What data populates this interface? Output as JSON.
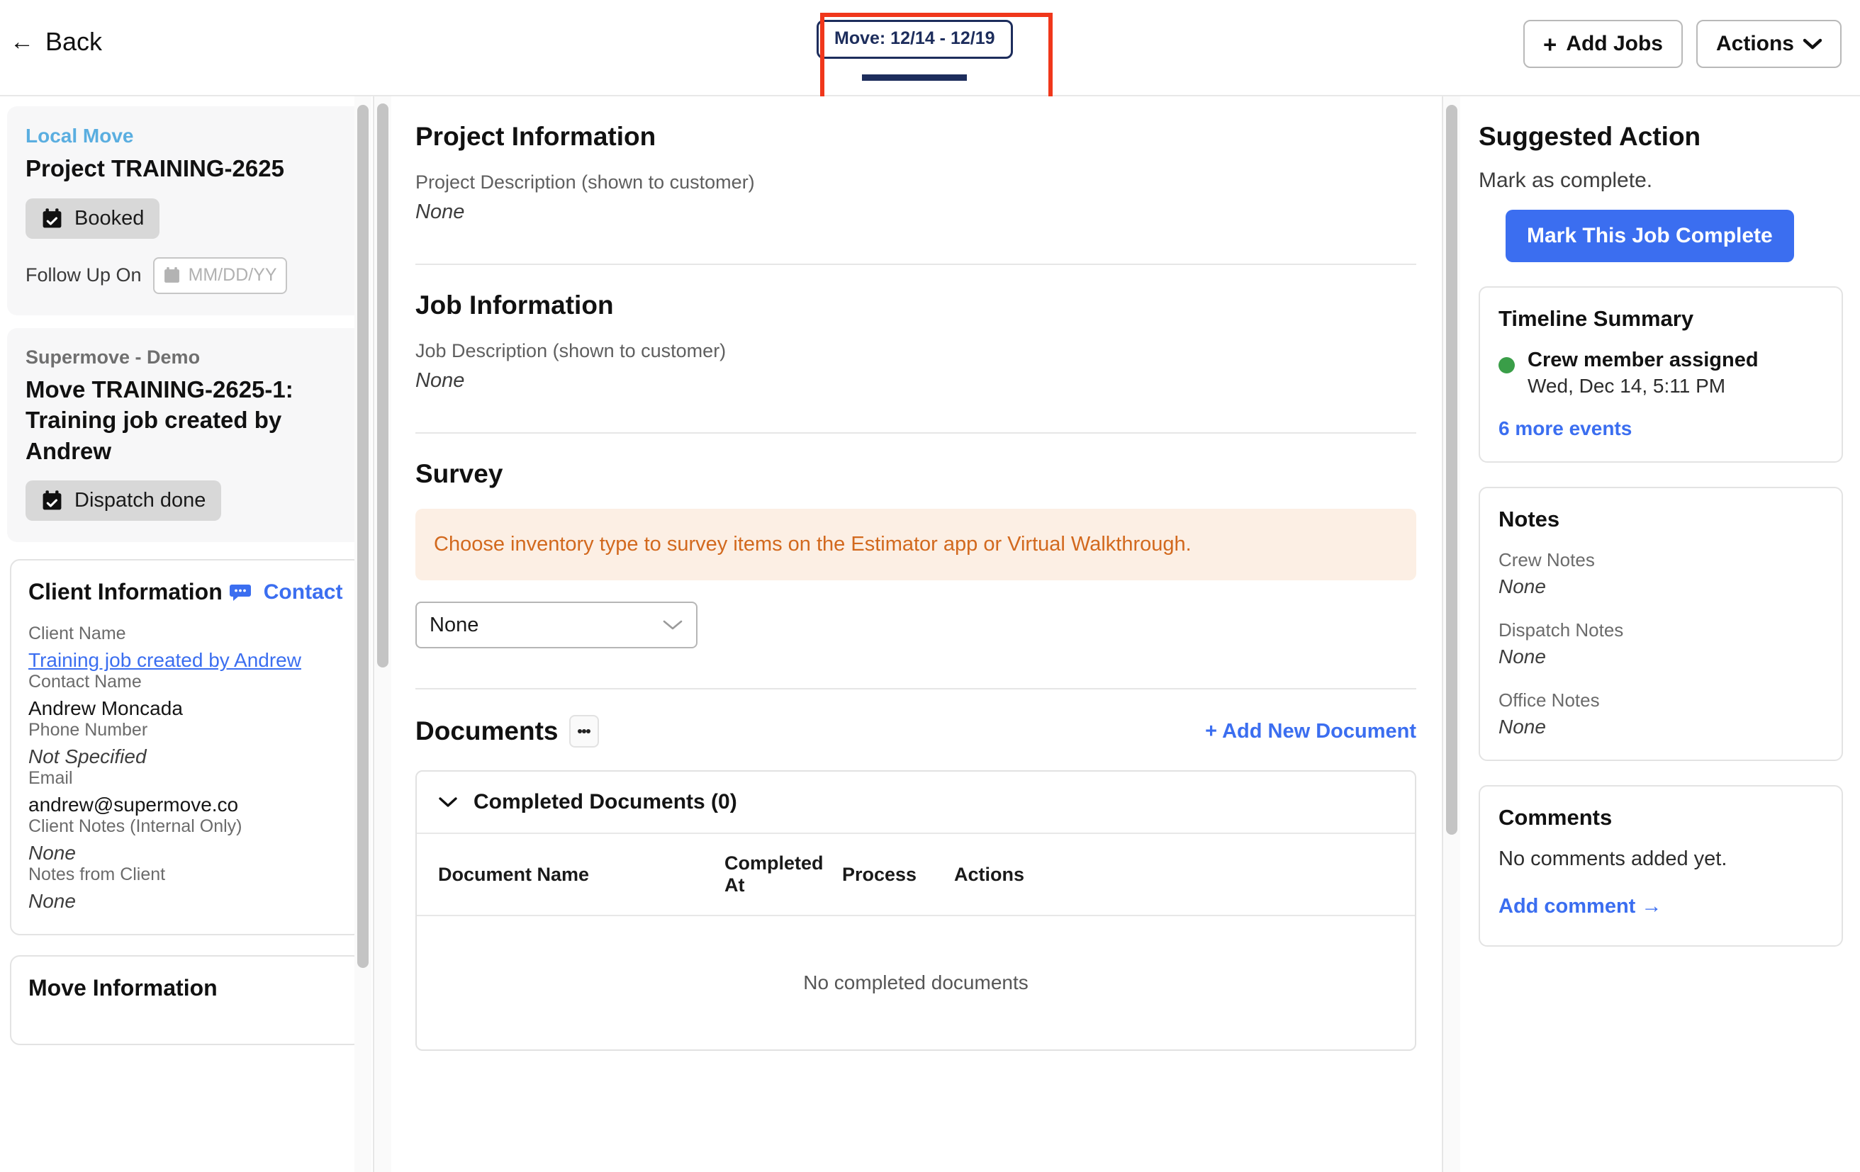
{
  "topbar": {
    "back_label": "Back",
    "back_arrow": "←",
    "tab_label": "Move: 12/14 - 12/19",
    "add_jobs_label": "Add Jobs",
    "plus_icon": "+",
    "actions_label": "Actions",
    "chevron_icon": "⌄",
    "highlight_color": "#f0371b",
    "tab_accent_color": "#1d2d5c"
  },
  "sidebar": {
    "project_card": {
      "kicker": "Local Move",
      "title": "Project TRAINING-2625",
      "status_label": "Booked",
      "followup_label": "Follow Up On",
      "followup_placeholder": "MM/DD/YY",
      "followup_value": ""
    },
    "move_card": {
      "kicker": "Supermove - Demo",
      "title": "Move TRAINING-2625-1: Training job created by Andrew",
      "status_label": "Dispatch done"
    },
    "client_card": {
      "title": "Client Information",
      "contact_link": "Contact",
      "fields": [
        {
          "label": "Client Name",
          "value": "Training job created by Andrew",
          "style": "link"
        },
        {
          "label": "Contact Name",
          "value": "Andrew Moncada",
          "style": "plain"
        },
        {
          "label": "Phone Number",
          "value": "Not Specified",
          "style": "italic"
        },
        {
          "label": "Email",
          "value": "andrew@supermove.co",
          "style": "plain"
        },
        {
          "label": "Client Notes (Internal Only)",
          "value": "None",
          "style": "italic"
        },
        {
          "label": "Notes from Client",
          "value": "None",
          "style": "italic"
        }
      ]
    },
    "move_info_card": {
      "title": "Move Information"
    }
  },
  "main": {
    "project_information": {
      "title": "Project Information",
      "description_label": "Project Description (shown to customer)",
      "description_value": "None"
    },
    "job_information": {
      "title": "Job Information",
      "description_label": "Job Description (shown to customer)",
      "description_value": "None"
    },
    "survey": {
      "title": "Survey",
      "alert_text": "Choose inventory type to survey items on the Estimator app or Virtual Walkthrough.",
      "alert_color": "#d2691e",
      "select_value": "None",
      "select_chevron": "⌄"
    },
    "documents": {
      "title": "Documents",
      "add_label": "+  Add New Document",
      "accordion_label": "Completed Documents (0)",
      "accordion_chevron": "⌄",
      "columns": [
        "Document Name",
        "Completed At",
        "Process",
        "Actions"
      ],
      "empty_text": "No completed documents",
      "rows": []
    }
  },
  "right": {
    "suggested_action": {
      "title": "Suggested Action",
      "subtitle": "Mark as complete.",
      "button_label": "Mark This Job Complete",
      "button_color": "#3b6ef0"
    },
    "timeline": {
      "title": "Timeline Summary",
      "events": [
        {
          "label": "Crew member assigned",
          "time": "Wed, Dec 14, 5:11 PM",
          "dot_color": "#3a9e48"
        }
      ],
      "more_link": "6 more events"
    },
    "notes": {
      "title": "Notes",
      "items": [
        {
          "label": "Crew Notes",
          "value": "None"
        },
        {
          "label": "Dispatch Notes",
          "value": "None"
        },
        {
          "label": "Office Notes",
          "value": "None"
        }
      ]
    },
    "comments": {
      "title": "Comments",
      "empty_text": "No comments added yet.",
      "add_label": "Add comment →"
    }
  }
}
